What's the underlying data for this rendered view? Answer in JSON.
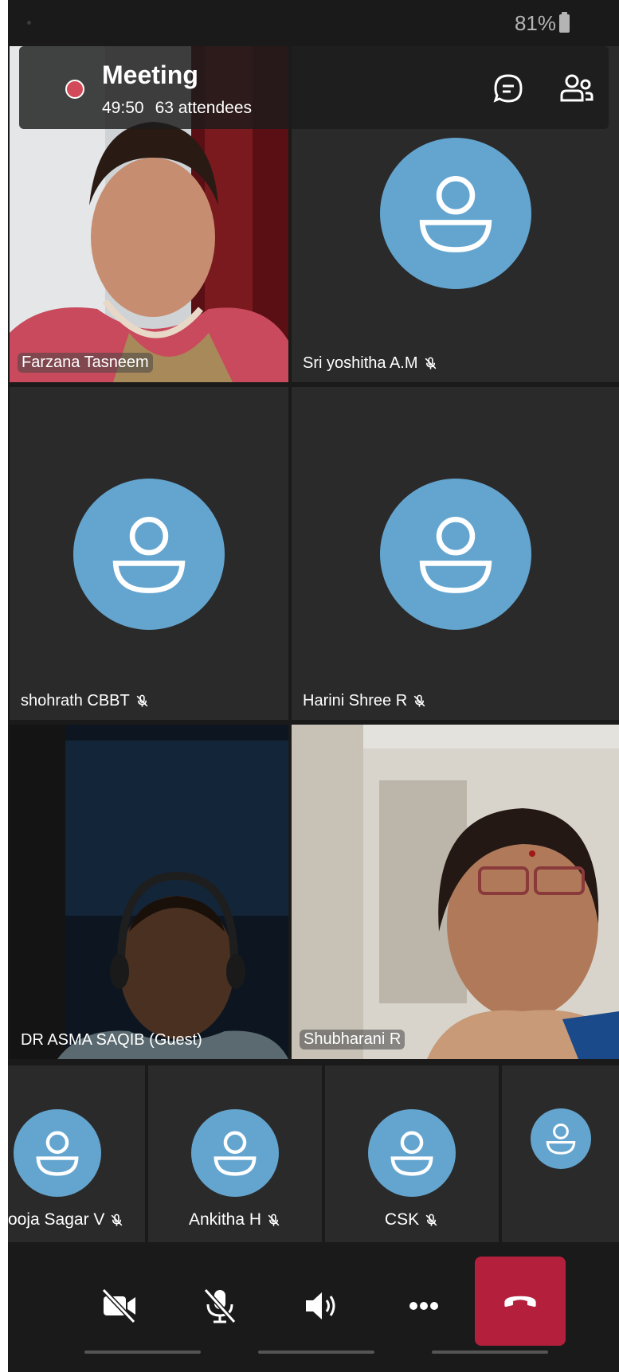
{
  "status_bar": {
    "battery": "81%"
  },
  "meeting": {
    "title": "Meeting",
    "duration": "49:50",
    "attendees": "63 attendees"
  },
  "tiles": [
    {
      "name": "Farzana Tasneem",
      "video": true,
      "muted": false
    },
    {
      "name": "Sri yoshitha A.M",
      "video": false,
      "muted": true
    },
    {
      "name": "shohrath CBBT",
      "video": false,
      "muted": true
    },
    {
      "name": "Harini Shree R",
      "video": false,
      "muted": true
    },
    {
      "name": "DR ASMA SAQIB (Guest)",
      "video": true,
      "muted": false
    },
    {
      "name": "Shubharani R",
      "video": true,
      "muted": false
    }
  ],
  "mini_tiles": [
    {
      "name": "ooja Sagar V",
      "muted": true
    },
    {
      "name": "Ankitha H",
      "muted": true
    },
    {
      "name": "CSK",
      "muted": true
    },
    {
      "name": "",
      "muted": false
    }
  ],
  "colors": {
    "avatar": "#64a5cf",
    "tile_bg": "#2a2a2a",
    "hangup": "#b4203c",
    "recording": "#d24a5a"
  },
  "controls": [
    "camera-off",
    "mic-off",
    "speaker",
    "more",
    "hang-up"
  ]
}
